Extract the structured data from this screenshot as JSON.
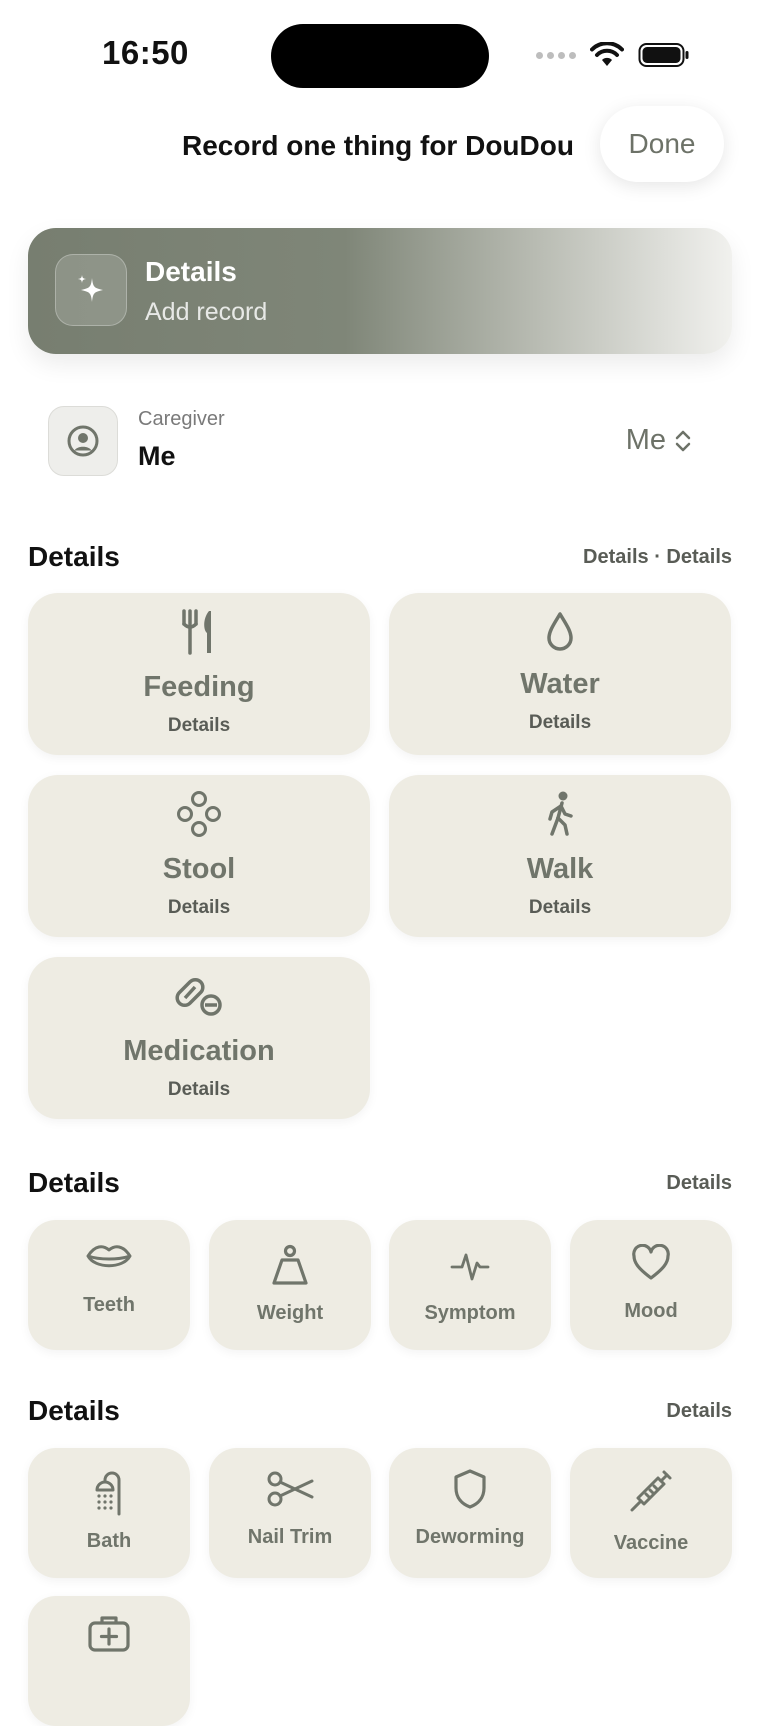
{
  "status_bar": {
    "time": "16:50"
  },
  "header": {
    "title": "Record one thing for DouDou",
    "done_label": "Done"
  },
  "banner": {
    "title": "Details",
    "subtitle": "Add record",
    "icon": "sparkles-icon"
  },
  "caregiver": {
    "label": "Caregiver",
    "name": "Me",
    "selected": "Me"
  },
  "section1": {
    "title": "Details",
    "link": "Details · Details",
    "items": [
      {
        "label": "Feeding",
        "sub": "Details",
        "icon": "fork-knife-icon"
      },
      {
        "label": "Water",
        "sub": "Details",
        "icon": "drop-icon"
      },
      {
        "label": "Stool",
        "sub": "Details",
        "icon": "circles-icon"
      },
      {
        "label": "Walk",
        "sub": "Details",
        "icon": "walking-person-icon"
      },
      {
        "label": "Medication",
        "sub": "Details",
        "icon": "pills-icon"
      }
    ]
  },
  "section2": {
    "title": "Details",
    "link": "Details",
    "items": [
      {
        "label": "Teeth",
        "icon": "mouth-icon"
      },
      {
        "label": "Weight",
        "icon": "scale-weight-icon"
      },
      {
        "label": "Symptom",
        "icon": "pulse-icon"
      },
      {
        "label": "Mood",
        "icon": "heart-icon"
      }
    ]
  },
  "section3": {
    "title": "Details",
    "link": "Details",
    "items": [
      {
        "label": "Bath",
        "icon": "shower-icon"
      },
      {
        "label": "Nail Trim",
        "icon": "scissors-icon"
      },
      {
        "label": "Deworming",
        "icon": "shield-icon"
      },
      {
        "label": "Vaccine",
        "icon": "syringe-icon"
      },
      {
        "label": "",
        "icon": "first-aid-kit-icon"
      }
    ]
  },
  "colors": {
    "card_bg": "#eeece3",
    "icon": "#70756b",
    "accent": "#777e70"
  }
}
